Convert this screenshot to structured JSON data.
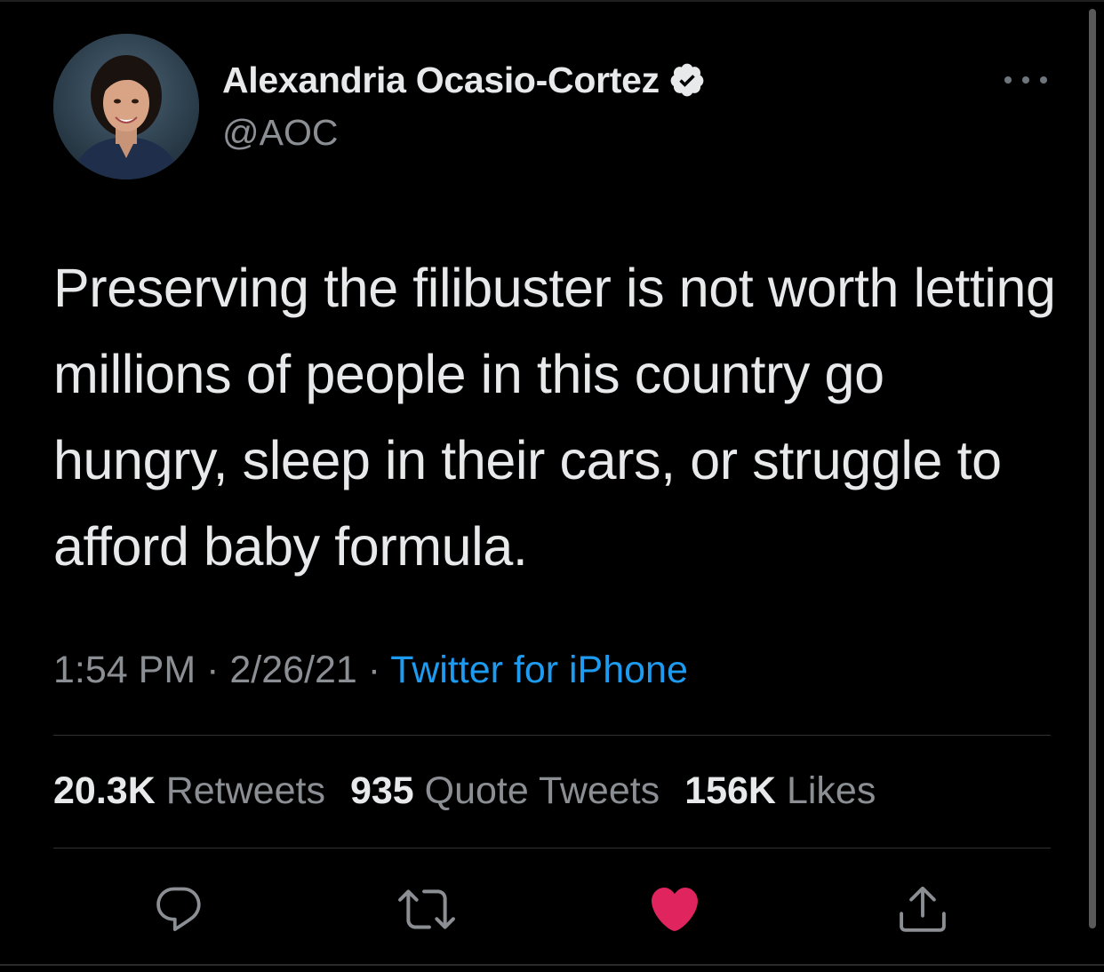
{
  "author": {
    "display_name": "Alexandria Ocasio-Cortez",
    "handle": "@AOC",
    "verified": true
  },
  "tweet": {
    "text": "Preserving the filibuster is not worth letting millions of people in this country go hungry, sleep in their cars, or struggle to afford baby formula.",
    "time": "1:54 PM",
    "date": "2/26/21",
    "separator": "·",
    "source": "Twitter for iPhone"
  },
  "stats": {
    "retweets_count": "20.3K",
    "retweets_label": "Retweets",
    "quote_tweets_count": "935",
    "quote_tweets_label": "Quote Tweets",
    "likes_count": "156K",
    "likes_label": "Likes"
  },
  "actions": {
    "icons": [
      "reply-icon",
      "retweet-icon",
      "like-icon",
      "share-icon"
    ],
    "liked": true
  },
  "colors": {
    "background": "#000000",
    "primary_text": "#e7e9ea",
    "secondary_text": "#8b8f94",
    "link": "#1d9bf0",
    "like": "#f91880",
    "divider": "#2f3336"
  }
}
